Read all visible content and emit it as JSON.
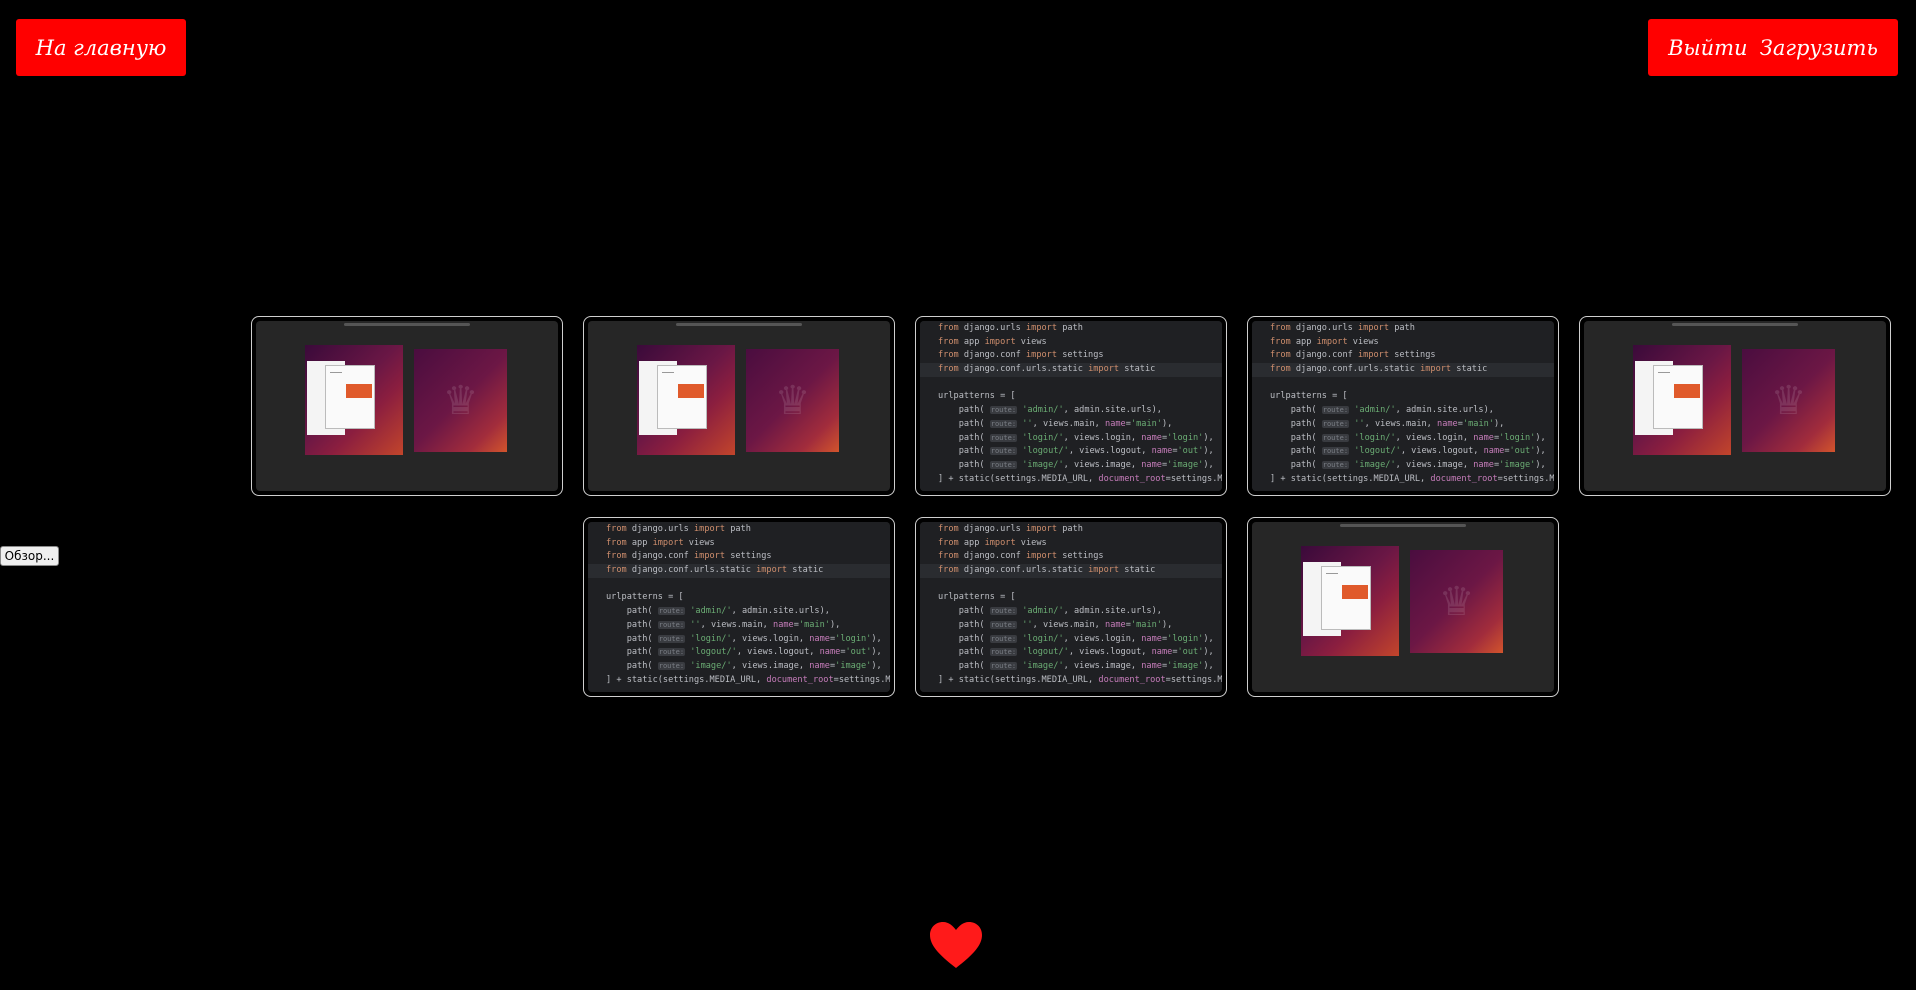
{
  "header": {
    "home_label": "На главную",
    "logout_label": "Выйти",
    "upload_label": "Загрузить"
  },
  "file_input": {
    "browse_label": "Обзор..."
  },
  "gallery": {
    "items": [
      {
        "type": "screenshot"
      },
      {
        "type": "screenshot"
      },
      {
        "type": "code"
      },
      {
        "type": "code"
      },
      {
        "type": "screenshot"
      },
      {
        "type": "code"
      },
      {
        "type": "code"
      },
      {
        "type": "screenshot"
      }
    ]
  },
  "code_snippet": {
    "lines": [
      "from django.urls import path",
      "from app import views",
      "from django.conf import settings",
      "from django.conf.urls.static import static",
      "",
      "urlpatterns = [",
      "    path( route: 'admin/', admin.site.urls),",
      "    path( route: '', views.main, name='main'),",
      "    path( route: 'login/', views.login, name='login'),",
      "    path( route: 'logout/', views.logout, name='out'),",
      "    path( route: 'image/', views.image, name='image'),",
      "] + static(settings.MEDIA_URL, document_root=settings.MED"
    ]
  },
  "footer": {
    "icon": "heart-icon"
  },
  "colors": {
    "accent": "#ff0000",
    "background": "#000000"
  }
}
